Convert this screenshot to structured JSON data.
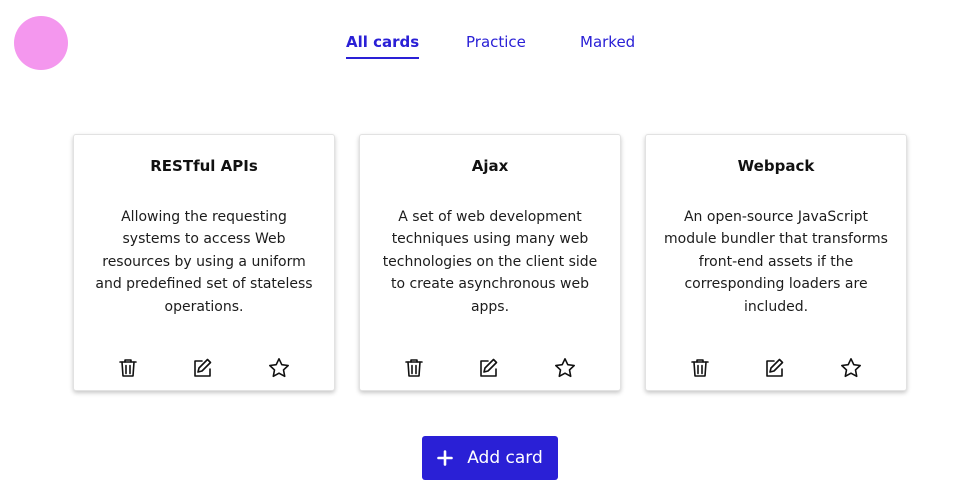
{
  "nav": {
    "tabs": [
      {
        "label": "All cards",
        "active": true
      },
      {
        "label": "Practice",
        "active": false
      },
      {
        "label": "Marked",
        "active": false
      }
    ]
  },
  "cards": [
    {
      "title": "RESTful APIs",
      "description": "Allowing the requesting systems to access Web resources by using a uniform and predefined set of stateless operations."
    },
    {
      "title": "Ajax",
      "description": "A set of web development techniques using many web technologies on the client side to create asynchronous web apps."
    },
    {
      "title": "Webpack",
      "description": "An open-source JavaScript module bundler that transforms front-end assets if the corresponding loaders are included."
    }
  ],
  "card_actions": {
    "icons": [
      "trash-icon",
      "edit-icon",
      "star-icon"
    ]
  },
  "add_button": {
    "label": "Add card",
    "icon": "plus-icon"
  },
  "colors": {
    "accent": "#2a20d6",
    "logo": "#f497ee"
  }
}
